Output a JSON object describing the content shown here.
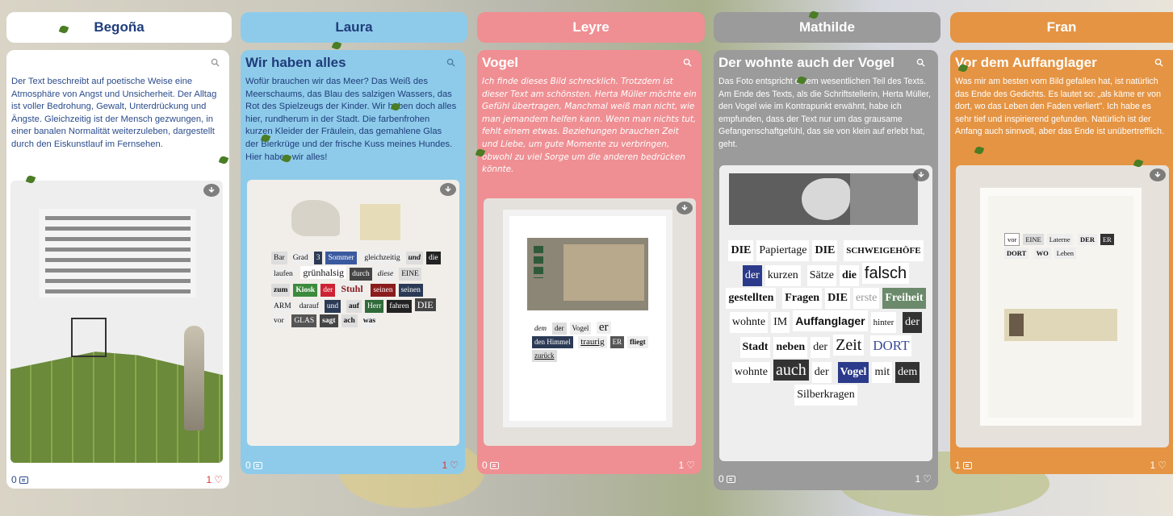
{
  "columns": [
    {
      "name": "Begoña",
      "header_bg": "#ffffff",
      "header_fg": "#1f3d7a",
      "card_bg": "#ffffff",
      "text_color": "#2b4c8c",
      "title": "",
      "body": "Der Text beschreibt auf poetische Weise eine Atmosphäre von Angst und Unsicherheit. Der Alltag ist voller  Bedrohung, Gewalt, Unterdrückung und Ängste. Gleichzeitig ist der Mensch gezwungen, in einer banalen   Normalität weiterzuleben, dargestellt durch  den Eiskunstlauf im Fernsehen.",
      "comments": "0",
      "likes": "1",
      "icons": {
        "search": "search-icon",
        "cloud": "cloud-download-icon",
        "comment": "comment-icon",
        "heart": "heart-icon"
      }
    },
    {
      "name": "Laura",
      "header_bg": "#8ecbea",
      "header_fg": "#1f3d7a",
      "card_bg": "#8ecbea",
      "text_color": "#1f3d7a",
      "title": "Wir haben alles",
      "body": "Wofür brauchen wir das Meer? Das Weiß des Meerschaums, das Blau des salzigen Wassers, das Rot des Spielzeugs der Kinder. Wir haben doch alles hier, rundherum in der Stadt. Die farbenfrohen kurzen Kleider der Fräulein, das gemahlene Glas der Bierkrüge und der frische Kuss meines Hundes. Hier haben wir alles!",
      "comments": "0",
      "likes": "1",
      "icons": {
        "search": "search-icon",
        "cloud": "cloud-download-icon",
        "comment": "comment-icon",
        "heart": "heart-icon"
      }
    },
    {
      "name": "Leyre",
      "header_bg": "#ef8f93",
      "header_fg": "#ffffff",
      "card_bg": "#ef8f93",
      "text_color": "#ffffff",
      "title": "Vogel",
      "body": "Ich finde dieses Bild schrecklich. Trotzdem ist dieser Text am schönsten. Herta Müller möchte ein Gefühl übertragen, Manchmal weiß man nicht, wie man jemandem helfen kann. Wenn man nichts tut, fehlt einem etwas. Beziehungen brauchen Zeit und Liebe, um gute Momente zu verbringen, obwohl zu viel Sorge um die anderen bedrücken könnte.",
      "comments": "0",
      "likes": "1",
      "icons": {
        "search": "search-icon",
        "cloud": "cloud-download-icon",
        "comment": "comment-icon",
        "heart": "heart-icon"
      }
    },
    {
      "name": "Mathilde",
      "header_bg": "#9b9b9b",
      "header_fg": "#ffffff",
      "card_bg": "#9b9b9b",
      "text_color": "#ffffff",
      "title": "Der wohnte auch der Vogel",
      "body": "Das Foto entspricht einem wesentlichen Teil des Texts. Am Ende des Texts, als die Schriftstellerin, Herta Müller, den Vogel wie im Kontrapunkt erwähnt, habe ich empfunden, dass der Text nur um das grausame Gefangenschaftgefühl, das sie von klein auf erlebt hat, geht.",
      "comments": "0",
      "likes": "1",
      "icons": {
        "search": "search-icon",
        "cloud": "cloud-download-icon",
        "comment": "comment-icon",
        "heart": "heart-icon"
      }
    },
    {
      "name": "Fran",
      "header_bg": "#e59443",
      "header_fg": "#ffffff",
      "card_bg": "#e59443",
      "text_color": "#ffffff",
      "title": "Vor dem Auffanglager",
      "body": "Was mir am besten vom Bild gefallen hat, ist natürlich das Ende des Gedichts. Es lautet so: „als käme er von dort, wo das Leben den Faden verliert\". Ich habe es sehr tief und inspirierend gefunden. Natürlich ist der Anfang auch sinnvoll, aber das Ende ist unübertrefflich.",
      "comments": "1",
      "likes": "1",
      "icons": {
        "search": "search-icon",
        "cloud": "cloud-download-icon",
        "comment": "comment-icon",
        "heart": "heart-icon"
      }
    }
  ],
  "collages": {
    "laura": [
      "Bar",
      "Grad",
      "3",
      "Sommer",
      "gleichzeitig",
      "und",
      "die",
      "laufen",
      "grünhalsig",
      "durch",
      "diese",
      "EINE",
      "zum",
      "Kiosk",
      "der",
      "seinen",
      "Stuhl",
      "seinen",
      "ARM",
      "darauf",
      "und",
      "auf",
      "Herr",
      "mal",
      "fahren",
      "DIE",
      "vor",
      "GLAS",
      "sagt",
      "ach",
      "was"
    ],
    "leyre": [
      "dem",
      "der",
      "Vogel",
      "er",
      "den Himmel",
      "traurig",
      "ER",
      "fliegt",
      "zurück"
    ],
    "mathilde": [
      "DIE",
      "Papiertage",
      "DIE",
      "SCHWEIGEHÖFE",
      "der",
      "kurzen",
      "Sätze",
      "die",
      "falsch",
      "gestellten",
      "Fragen",
      "DIE",
      "erste",
      "Freiheit",
      "wohnte",
      "IM",
      "Auffanglager",
      "hinter",
      "der",
      "Stadt",
      "neben",
      "der",
      "Zeit",
      "DORT",
      "wohnte",
      "auch",
      "der",
      "Vogel",
      "mit",
      "dem",
      "Silberkragen"
    ],
    "fran": [
      "vor",
      "EINE",
      "Laterne",
      "DER",
      "ER",
      "DORT",
      "WO",
      "Leben"
    ]
  }
}
